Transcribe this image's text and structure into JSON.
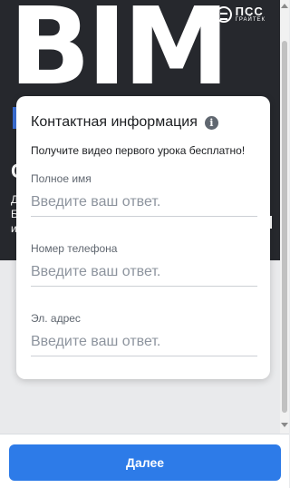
{
  "hero": {
    "headline": "BIM",
    "overlay_big_letter": "С",
    "overlay_lines": [
      "Д",
      "Б",
      "и"
    ]
  },
  "logo": {
    "main": "ПСС",
    "sub": "ГРАЙТЕК"
  },
  "form": {
    "title": "Контактная информация",
    "info_icon": "info-icon",
    "subtitle": "Получите видео первого урока бесплатно!",
    "fields": [
      {
        "label": "Полное имя",
        "placeholder": "Введите ваш ответ.",
        "value": ""
      },
      {
        "label": "Номер телефона",
        "placeholder": "Введите ваш ответ.",
        "value": ""
      },
      {
        "label": "Эл. адрес",
        "placeholder": "Введите ваш ответ.",
        "value": ""
      }
    ]
  },
  "footer": {
    "next_label": "Далее"
  },
  "colors": {
    "accent": "#2d7be8",
    "hero_bg": "#26282d"
  }
}
